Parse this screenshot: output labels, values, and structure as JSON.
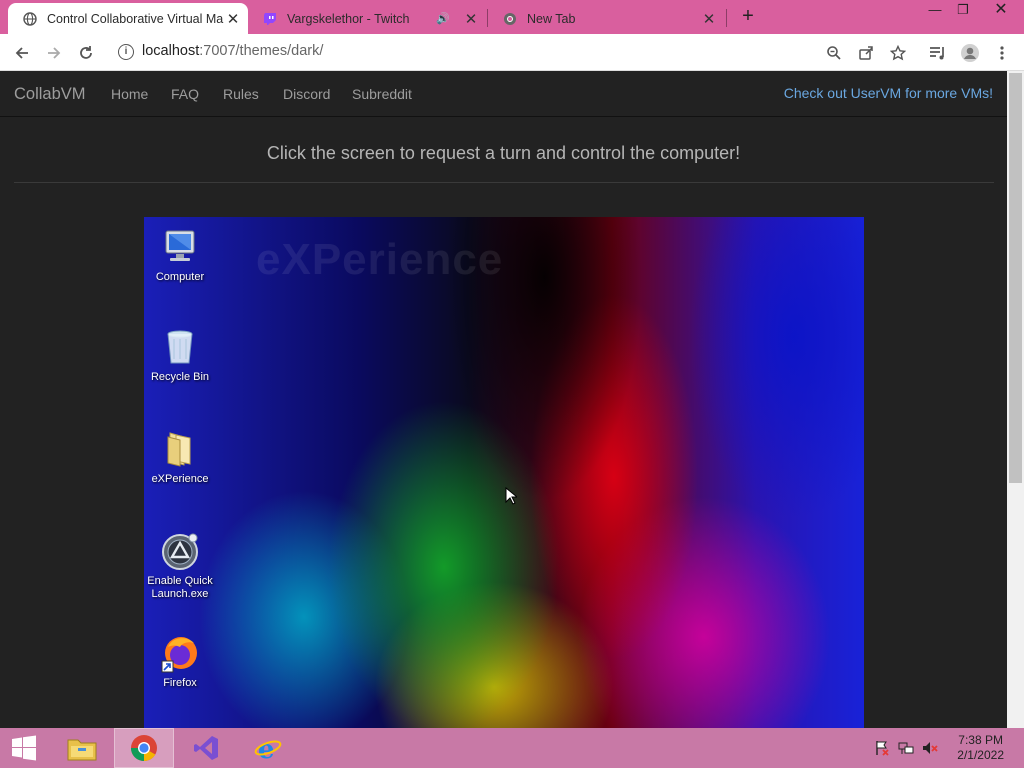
{
  "browser": {
    "tabs": [
      {
        "title": "Control Collaborative Virtual Ma",
        "icon": "globe-icon",
        "active": true
      },
      {
        "title": "Vargskelethor - Twitch",
        "icon": "twitch-icon",
        "audio": true
      },
      {
        "title": "New Tab",
        "icon": "chrome-icon"
      }
    ],
    "new_tab_symbol": "+",
    "address": {
      "host": "localhost",
      "path": ":7007/themes/dark/"
    }
  },
  "site": {
    "brand": "CollabVM",
    "nav": [
      "Home",
      "FAQ",
      "Rules",
      "Discord",
      "Subreddit"
    ],
    "promo": "Check out UserVM for more VMs!",
    "headline": "Click the screen to request a turn and control the computer!"
  },
  "vm": {
    "watermark": "eXPerience",
    "icons": [
      {
        "label": "Computer",
        "icon": "computer-icon"
      },
      {
        "label": "Recycle Bin",
        "icon": "recycle-bin-icon"
      },
      {
        "label": "eXPerience",
        "icon": "folder-icon"
      },
      {
        "label": "Enable Quick Launch.exe",
        "icon": "quick-launch-icon"
      },
      {
        "label": "Firefox",
        "icon": "firefox-icon"
      }
    ]
  },
  "taskbar": {
    "apps": [
      "start-icon",
      "file-explorer-icon",
      "chrome-icon",
      "visual-studio-icon",
      "internet-explorer-icon"
    ],
    "clock": {
      "time": "7:38 PM",
      "date": "2/1/2022"
    }
  },
  "colors": {
    "tabstrip": "#d95f9e",
    "taskbar": "#c879a6",
    "page_bg": "#222222",
    "link": "#6aa7e0"
  }
}
